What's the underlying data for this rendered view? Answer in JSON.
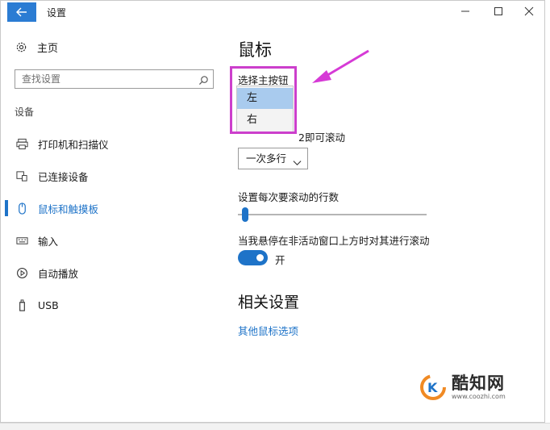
{
  "window": {
    "title": "设置"
  },
  "sidebar": {
    "home_label": "主页",
    "search_placeholder": "查找设置",
    "section_header": "设备",
    "items": [
      {
        "label": "打印机和扫描仪",
        "icon": "printer-icon"
      },
      {
        "label": "已连接设备",
        "icon": "connected-devices-icon"
      },
      {
        "label": "鼠标和触摸板",
        "icon": "mouse-icon",
        "active": true
      },
      {
        "label": "输入",
        "icon": "keyboard-icon"
      },
      {
        "label": "自动播放",
        "icon": "autoplay-icon"
      },
      {
        "label": "USB",
        "icon": "usb-icon"
      }
    ]
  },
  "main": {
    "title": "鼠标",
    "primary_button_label": "选择主按钮",
    "primary_button_dropdown": {
      "options": [
        "左",
        "右"
      ],
      "selected": "左"
    },
    "scroll_label_partial": "滚动鼠标滚轮即可滚动",
    "scroll_label_visible": "2即可滚动",
    "scroll_mode_value": "一次多行",
    "lines_label": "设置每次要滚动的行数",
    "lines_slider_fraction": 0.02,
    "inactive_scroll_label": "当我悬停在非活动窗口上方时对其进行滚动",
    "inactive_scroll_state": "开",
    "related_title": "相关设置",
    "more_mouse_options_link": "其他鼠标选项"
  },
  "watermark": {
    "brand": "酷知网",
    "url": "www.coozhi.com"
  },
  "colors": {
    "accent": "#1e73c8",
    "highlight_border": "#cc3fcc",
    "back_button": "#2b7cd3"
  }
}
